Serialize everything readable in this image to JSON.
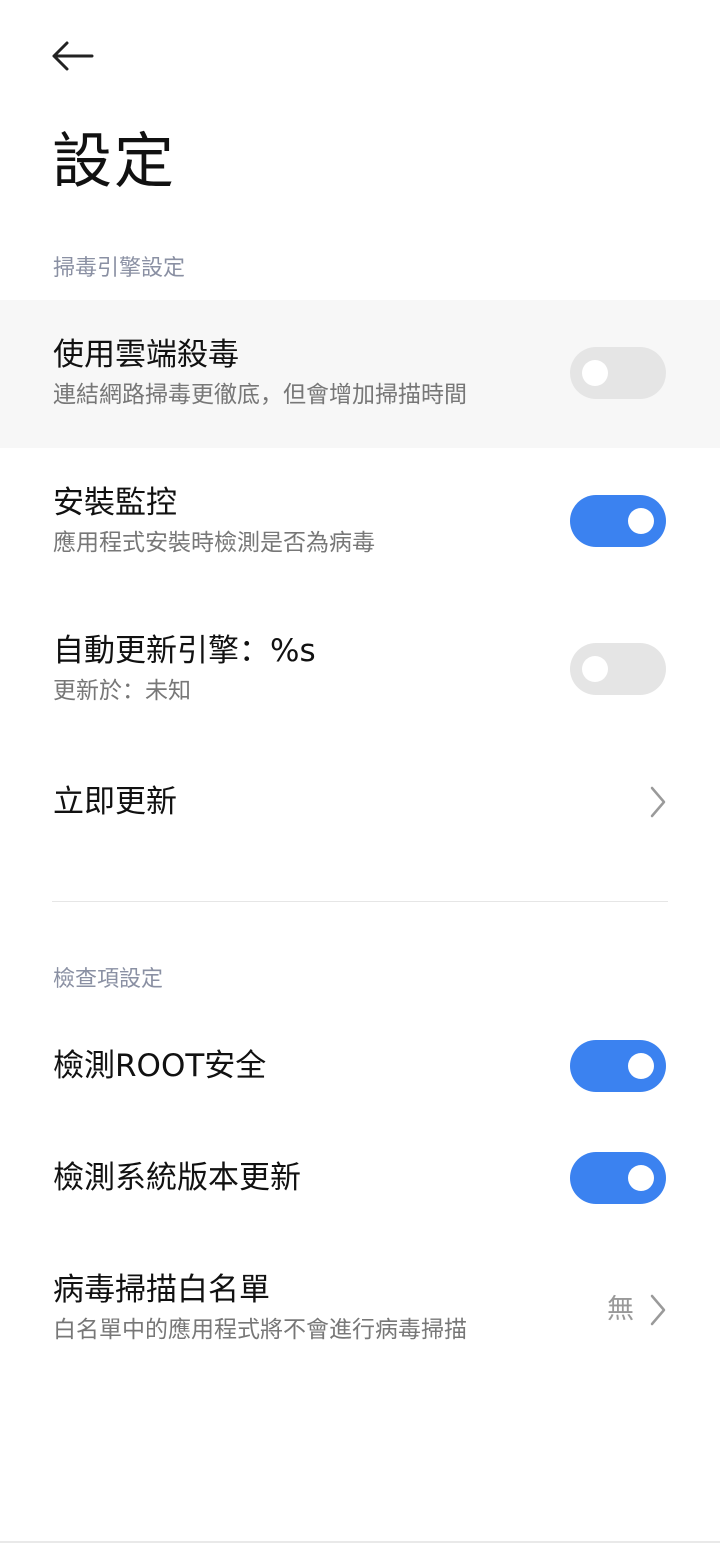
{
  "header": {
    "back_icon": "arrow-left-icon",
    "title": "設定"
  },
  "sections": [
    {
      "header": "掃毒引擎設定",
      "items": [
        {
          "title": "使用雲端殺毒",
          "subtitle": "連結網路掃毒更徹底，但會增加掃描時間",
          "type": "toggle",
          "checked": false
        },
        {
          "title": "安裝監控",
          "subtitle": "應用程式安裝時檢測是否為病毒",
          "type": "toggle",
          "checked": true
        },
        {
          "title": "自動更新引擎：%s",
          "subtitle": "更新於：未知",
          "type": "toggle",
          "checked": false
        },
        {
          "title": "立即更新",
          "type": "link",
          "icon": "chevron-right-icon"
        }
      ]
    },
    {
      "header": "檢查項設定",
      "items": [
        {
          "title": "檢測ROOT安全",
          "type": "toggle",
          "checked": true
        },
        {
          "title": "檢測系統版本更新",
          "type": "toggle",
          "checked": true
        },
        {
          "title": "病毒掃描白名單",
          "subtitle": "白名單中的應用程式將不會進行病毒掃描",
          "type": "link",
          "value": "無",
          "icon": "chevron-right-icon"
        }
      ]
    }
  ],
  "colors": {
    "accent": "#3b82f0",
    "toggle_off": "#e5e5e5",
    "section_header": "#8a90a3"
  }
}
